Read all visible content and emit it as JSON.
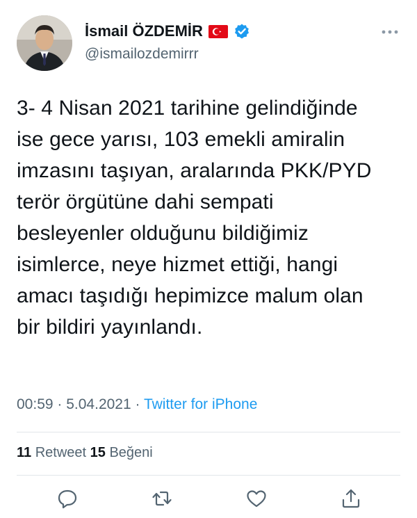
{
  "author": {
    "display_name": "İsmail ÖZDEMİR",
    "handle": "@ismailozdemirrr",
    "flag_icon": "turkish-flag-icon",
    "verified_icon": "verified-badge-icon",
    "verified_color": "#1d9bf0"
  },
  "tweet": {
    "text": "3- 4 Nisan 2021 tarihine gelindiğinde\nise gece yarısı, 103 emekli amiralin\nimzasını taşıyan, aralarında PKK/PYD\nterör örgütüne dahi sempati\nbesleyenler olduğunu bildiğimiz\nisimlerce, neye hizmet ettiği, hangi\namacı taşıdığı hepimizce malum olan\nbir bildiri yayınlandı.",
    "time": "00:59",
    "separator": " · ",
    "date": "5.04.2021",
    "source": "Twitter for iPhone"
  },
  "stats": {
    "retweet_count": "11",
    "retweet_label": "Retweet",
    "like_count": "15",
    "like_label": "Beğeni"
  },
  "actions": {
    "reply_icon": "reply-icon",
    "retweet_icon": "retweet-icon",
    "like_icon": "heart-icon",
    "share_icon": "share-icon",
    "more_icon": "more-dots-icon"
  },
  "colors": {
    "text": "#0f1419",
    "secondary": "#536471",
    "link": "#1d9bf0",
    "divider": "#e1e6ea"
  }
}
